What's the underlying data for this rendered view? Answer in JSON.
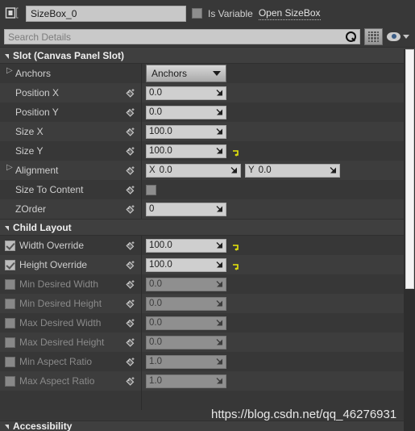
{
  "header": {
    "widget_icon": "sizebox-widget-icon",
    "name_value": "SizeBox_0",
    "is_variable_label": "Is Variable",
    "is_variable_checked": false,
    "open_link": "Open SizeBox"
  },
  "search": {
    "placeholder": "Search Details",
    "value": "",
    "search_icon": "search-icon",
    "grid_icon": "grid-view-icon",
    "eye_icon": "visibility-eye-icon",
    "caret_icon": "chevron-down-icon"
  },
  "categories": [
    {
      "title": "Slot (Canvas Panel Slot)",
      "expanded": true,
      "rows": [
        {
          "label": "Anchors",
          "type": "dropdown",
          "value": "Anchors",
          "expandable": true,
          "pin": false,
          "reset": false
        },
        {
          "label": "Position X",
          "type": "number",
          "value": "0.0",
          "expandable": false,
          "pin": true,
          "reset": false
        },
        {
          "label": "Position Y",
          "type": "number",
          "value": "0.0",
          "expandable": false,
          "pin": true,
          "reset": false
        },
        {
          "label": "Size X",
          "type": "number",
          "value": "100.0",
          "expandable": false,
          "pin": true,
          "reset": false
        },
        {
          "label": "Size Y",
          "type": "number",
          "value": "100.0",
          "expandable": false,
          "pin": true,
          "reset": true
        },
        {
          "label": "Alignment",
          "type": "vector2",
          "value_x": "0.0",
          "value_y": "0.0",
          "axis_x": "X",
          "axis_y": "Y",
          "expandable": true,
          "pin": true,
          "reset": false
        },
        {
          "label": "Size To Content",
          "type": "checkbox",
          "checked": false,
          "expandable": false,
          "pin": true,
          "reset": false
        },
        {
          "label": "ZOrder",
          "type": "number",
          "value": "0",
          "expandable": false,
          "pin": true,
          "reset": false
        }
      ]
    },
    {
      "title": "Child Layout",
      "expanded": true,
      "rows": [
        {
          "label": "Width Override",
          "type": "number",
          "value": "100.0",
          "checkbox": true,
          "checked": true,
          "enabled": true,
          "pin": true,
          "reset": true
        },
        {
          "label": "Height Override",
          "type": "number",
          "value": "100.0",
          "checkbox": true,
          "checked": true,
          "enabled": true,
          "pin": true,
          "reset": true
        },
        {
          "label": "Min Desired Width",
          "type": "number",
          "value": "0.0",
          "checkbox": true,
          "checked": false,
          "enabled": false,
          "pin": true,
          "reset": false
        },
        {
          "label": "Min Desired Height",
          "type": "number",
          "value": "0.0",
          "checkbox": true,
          "checked": false,
          "enabled": false,
          "pin": true,
          "reset": false
        },
        {
          "label": "Max Desired Width",
          "type": "number",
          "value": "0.0",
          "checkbox": true,
          "checked": false,
          "enabled": false,
          "pin": true,
          "reset": false
        },
        {
          "label": "Max Desired Height",
          "type": "number",
          "value": "0.0",
          "checkbox": true,
          "checked": false,
          "enabled": false,
          "pin": true,
          "reset": false
        },
        {
          "label": "Min Aspect Ratio",
          "type": "number",
          "value": "1.0",
          "checkbox": true,
          "checked": false,
          "enabled": false,
          "pin": true,
          "reset": false
        },
        {
          "label": "Max Aspect Ratio",
          "type": "number",
          "value": "1.0",
          "checkbox": true,
          "checked": false,
          "enabled": false,
          "pin": true,
          "reset": false
        }
      ]
    }
  ],
  "bottom_category": {
    "title": "Accessibility"
  },
  "watermark": "https://blog.csdn.net/qq_46276931",
  "colors": {
    "panel_bg": "#383838",
    "row_alt": "#3d3d3d",
    "category_bg": "#3f3f3f",
    "field_bg": "#cfcfcf",
    "field_disabled_bg": "#8f8f8f",
    "text": "#cfcfcf",
    "reset_yellow": "#e8e80a",
    "scrollbar_thumb": "#f4f4f4"
  }
}
